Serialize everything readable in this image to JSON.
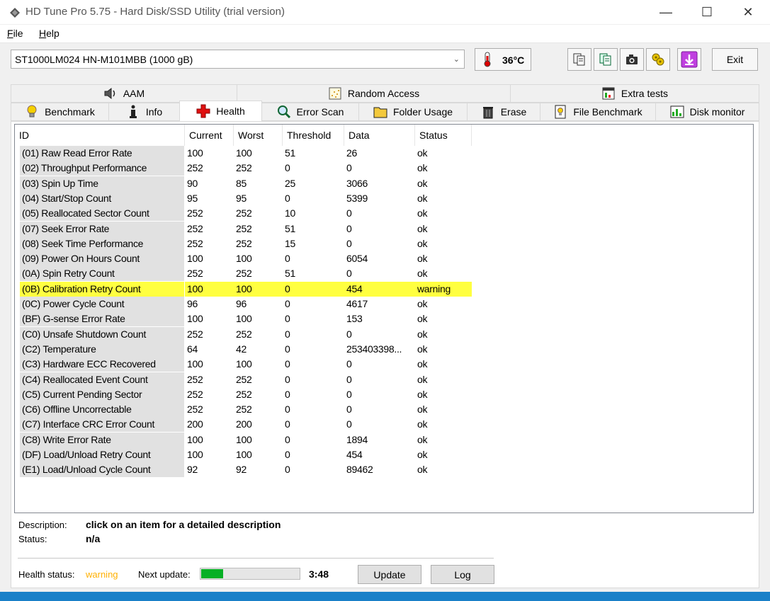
{
  "window": {
    "title": "HD Tune Pro 5.75 - Hard Disk/SSD Utility (trial version)",
    "minimize": "—",
    "maximize": "☐",
    "close": "✕"
  },
  "menu": [
    {
      "label": "File"
    },
    {
      "label": "Help"
    }
  ],
  "toolbar": {
    "drive": "ST1000LM024 HN-M101MBB (1000 gB)",
    "temperature": "36°C",
    "exit_label": "Exit"
  },
  "tabs_row1": [
    {
      "label": "AAM",
      "icon": "speaker-icon"
    },
    {
      "label": "Random Access",
      "icon": "random-access-icon"
    },
    {
      "label": "Extra tests",
      "icon": "extra-tests-icon"
    }
  ],
  "tabs_row2": [
    {
      "label": "Benchmark",
      "icon": "lightbulb-icon"
    },
    {
      "label": "Info",
      "icon": "info-icon"
    },
    {
      "label": "Health",
      "icon": "health-cross-icon",
      "active": true
    },
    {
      "label": "Error Scan",
      "icon": "magnifier-icon"
    },
    {
      "label": "Folder Usage",
      "icon": "folder-icon"
    },
    {
      "label": "Erase",
      "icon": "trash-icon"
    },
    {
      "label": "File Benchmark",
      "icon": "file-benchmark-icon"
    },
    {
      "label": "Disk monitor",
      "icon": "disk-monitor-icon"
    }
  ],
  "table": {
    "headers": [
      "ID",
      "Current",
      "Worst",
      "Threshold",
      "Data",
      "Status"
    ],
    "rows": [
      [
        "(01) Raw Read Error Rate",
        "100",
        "100",
        "51",
        "26",
        "ok"
      ],
      [
        "(02) Throughput Performance",
        "252",
        "252",
        "0",
        "0",
        "ok"
      ],
      [
        "(03) Spin Up Time",
        "90",
        "85",
        "25",
        "3066",
        "ok"
      ],
      [
        "(04) Start/Stop Count",
        "95",
        "95",
        "0",
        "5399",
        "ok"
      ],
      [
        "(05) Reallocated Sector Count",
        "252",
        "252",
        "10",
        "0",
        "ok"
      ],
      [
        "(07) Seek Error Rate",
        "252",
        "252",
        "51",
        "0",
        "ok"
      ],
      [
        "(08) Seek Time Performance",
        "252",
        "252",
        "15",
        "0",
        "ok"
      ],
      [
        "(09) Power On Hours Count",
        "100",
        "100",
        "0",
        "6054",
        "ok"
      ],
      [
        "(0A) Spin Retry Count",
        "252",
        "252",
        "51",
        "0",
        "ok"
      ],
      [
        "(0B) Calibration Retry Count",
        "100",
        "100",
        "0",
        "454",
        "warning"
      ],
      [
        "(0C) Power Cycle Count",
        "96",
        "96",
        "0",
        "4617",
        "ok"
      ],
      [
        "(BF) G-sense Error Rate",
        "100",
        "100",
        "0",
        "153",
        "ok"
      ],
      [
        "(C0) Unsafe Shutdown Count",
        "252",
        "252",
        "0",
        "0",
        "ok"
      ],
      [
        "(C2) Temperature",
        "64",
        "42",
        "0",
        "253403398...",
        "ok"
      ],
      [
        "(C3) Hardware ECC Recovered",
        "100",
        "100",
        "0",
        "0",
        "ok"
      ],
      [
        "(C4) Reallocated Event Count",
        "252",
        "252",
        "0",
        "0",
        "ok"
      ],
      [
        "(C5) Current Pending Sector",
        "252",
        "252",
        "0",
        "0",
        "ok"
      ],
      [
        "(C6) Offline Uncorrectable",
        "252",
        "252",
        "0",
        "0",
        "ok"
      ],
      [
        "(C7) Interface CRC Error Count",
        "200",
        "200",
        "0",
        "0",
        "ok"
      ],
      [
        "(C8) Write Error Rate",
        "100",
        "100",
        "0",
        "1894",
        "ok"
      ],
      [
        "(DF) Load/Unload Retry Count",
        "100",
        "100",
        "0",
        "454",
        "ok"
      ],
      [
        "(E1) Load/Unload Cycle Count",
        "92",
        "92",
        "0",
        "89462",
        "ok"
      ]
    ]
  },
  "description": {
    "desc_label": "Description:",
    "desc_value": "click on an item for a detailed description",
    "status_label": "Status:",
    "status_value": "n/a"
  },
  "footer": {
    "health_label": "Health status:",
    "health_value": "warning",
    "next_label": "Next update:",
    "progress_fraction": 0.22,
    "time": "3:48",
    "update_label": "Update",
    "log_label": "Log"
  },
  "colors": {
    "warning_row": "#ffff40",
    "warning_text": "#ffb000",
    "progress": "#06b025"
  }
}
